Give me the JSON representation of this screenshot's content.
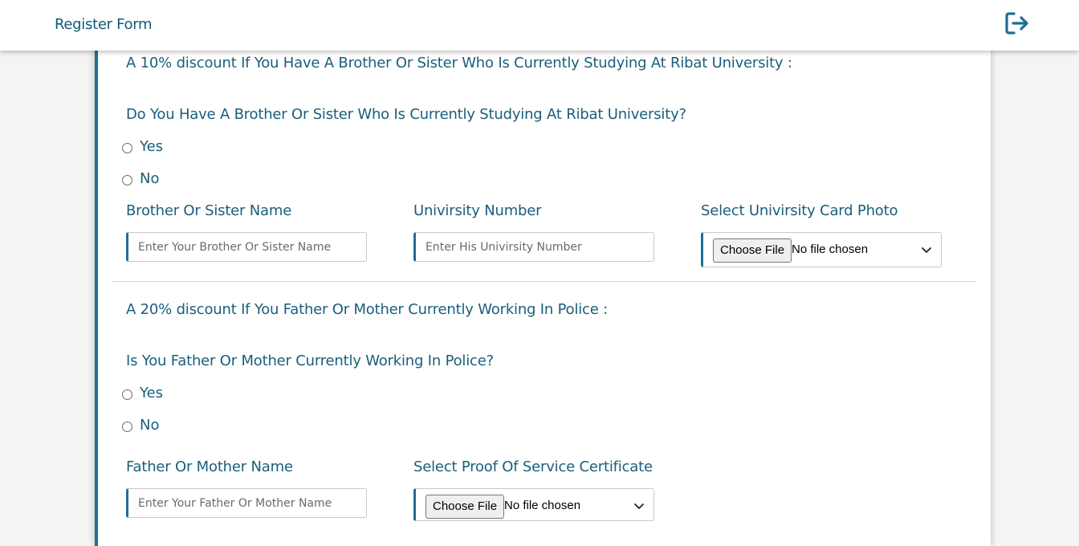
{
  "header": {
    "title": "Register Form",
    "logout_icon": "sign-out-icon"
  },
  "section1": {
    "title": "A 10% discount If You Have A Brother Or Sister Who Is Currently Studying At Ribat University :",
    "question": "Do You Have A Brother Or Sister Who Is Currently Studying At Ribat University?",
    "options": [
      "Yes",
      "No"
    ],
    "fields": {
      "sibling_name": {
        "label": "Brother Or Sister Name",
        "placeholder": "Enter Your Brother Or Sister Name",
        "value": ""
      },
      "university_number": {
        "label": "Univirsity Number",
        "placeholder": "Enter His Univirsity Number",
        "value": ""
      },
      "card_photo": {
        "label": "Select Univirsity Card Photo",
        "button": "Choose File",
        "status": "No file chosen"
      }
    }
  },
  "section2": {
    "title": "A 20% discount If You Father Or Mother Currently Working In Police :",
    "question": "Is You Father Or Mother Currently Working In Police?",
    "options": [
      "Yes",
      "No"
    ],
    "fields": {
      "parent_name": {
        "label": "Father Or Mother Name",
        "placeholder": "Enter Your Father Or Mother Name",
        "value": ""
      },
      "service_certificate": {
        "label": "Select Proof Of Service Certificate",
        "button": "Choose File",
        "status": "No file chosen"
      }
    }
  },
  "colors": {
    "accent": "#1d6f94",
    "text": "#1a5e7c",
    "background": "#f4f4f4"
  }
}
